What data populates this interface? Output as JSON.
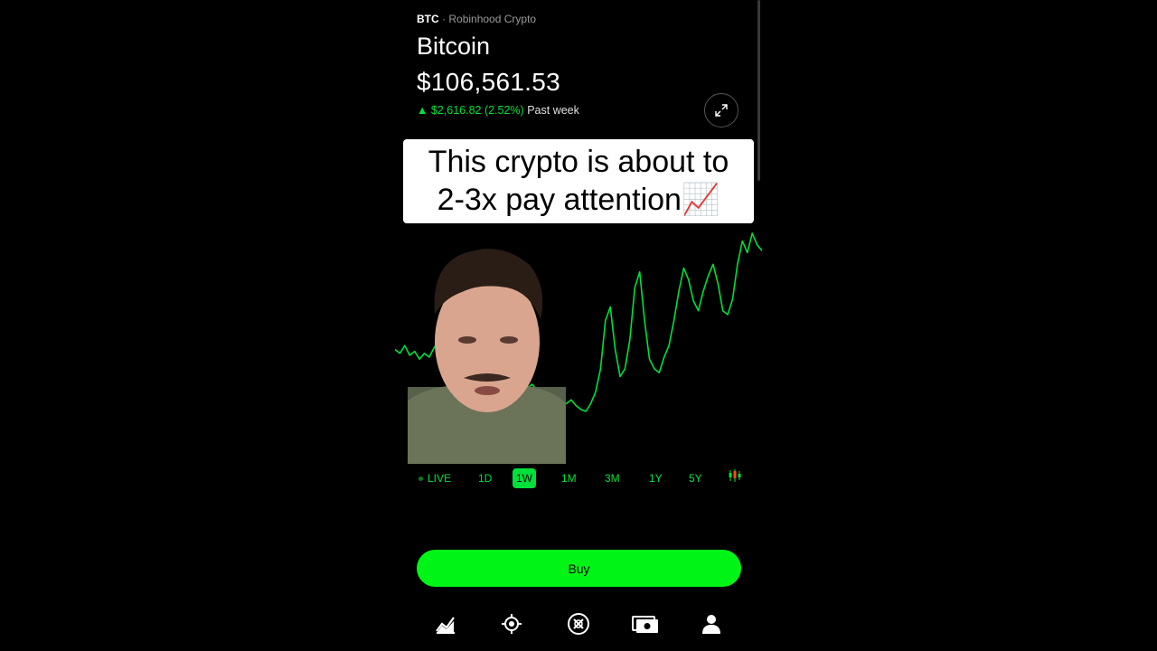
{
  "header": {
    "symbol": "BTC",
    "separator": "·",
    "exchange": "Robinhood Crypto",
    "asset_name": "Bitcoin",
    "price": "$106,561.53",
    "change_arrow": "▲",
    "change_amount": "$2,616.82 (2.52%)",
    "change_period": "Past week"
  },
  "caption": {
    "line1": "This crypto is about to",
    "line2": "2-3x pay attention",
    "emoji": "📈"
  },
  "time_ranges": [
    {
      "label": "LIVE",
      "active": false
    },
    {
      "label": "1D",
      "active": false
    },
    {
      "label": "1W",
      "active": true
    },
    {
      "label": "1M",
      "active": false
    },
    {
      "label": "3M",
      "active": false
    },
    {
      "label": "1Y",
      "active": false
    },
    {
      "label": "5Y",
      "active": false
    }
  ],
  "buy_button": {
    "label": "Buy"
  },
  "tabbar": {
    "items": [
      "chart-icon",
      "discover-icon",
      "crypto-icon",
      "cash-icon",
      "account-icon"
    ]
  },
  "colors": {
    "accent_green": "#00e03a",
    "buy_green": "#00f516",
    "background": "#000000"
  },
  "chart_data": {
    "type": "line",
    "series": [
      {
        "values": [
          40,
          38,
          42,
          37,
          39,
          35,
          38,
          36,
          41,
          44,
          40,
          38,
          35,
          33,
          30,
          29,
          31,
          28,
          30,
          27,
          26,
          28,
          25,
          23,
          22,
          24,
          21,
          20,
          22,
          19,
          18,
          17,
          16,
          15,
          13,
          12,
          14,
          11,
          9,
          8,
          12,
          18,
          30,
          55,
          62,
          40,
          26,
          30,
          45,
          72,
          80,
          55,
          35,
          30,
          28,
          36,
          42,
          55,
          70,
          82,
          76,
          65,
          60,
          70,
          78,
          84,
          74,
          60,
          58,
          66,
          84,
          96,
          90,
          100,
          94,
          91
        ]
      }
    ]
  }
}
